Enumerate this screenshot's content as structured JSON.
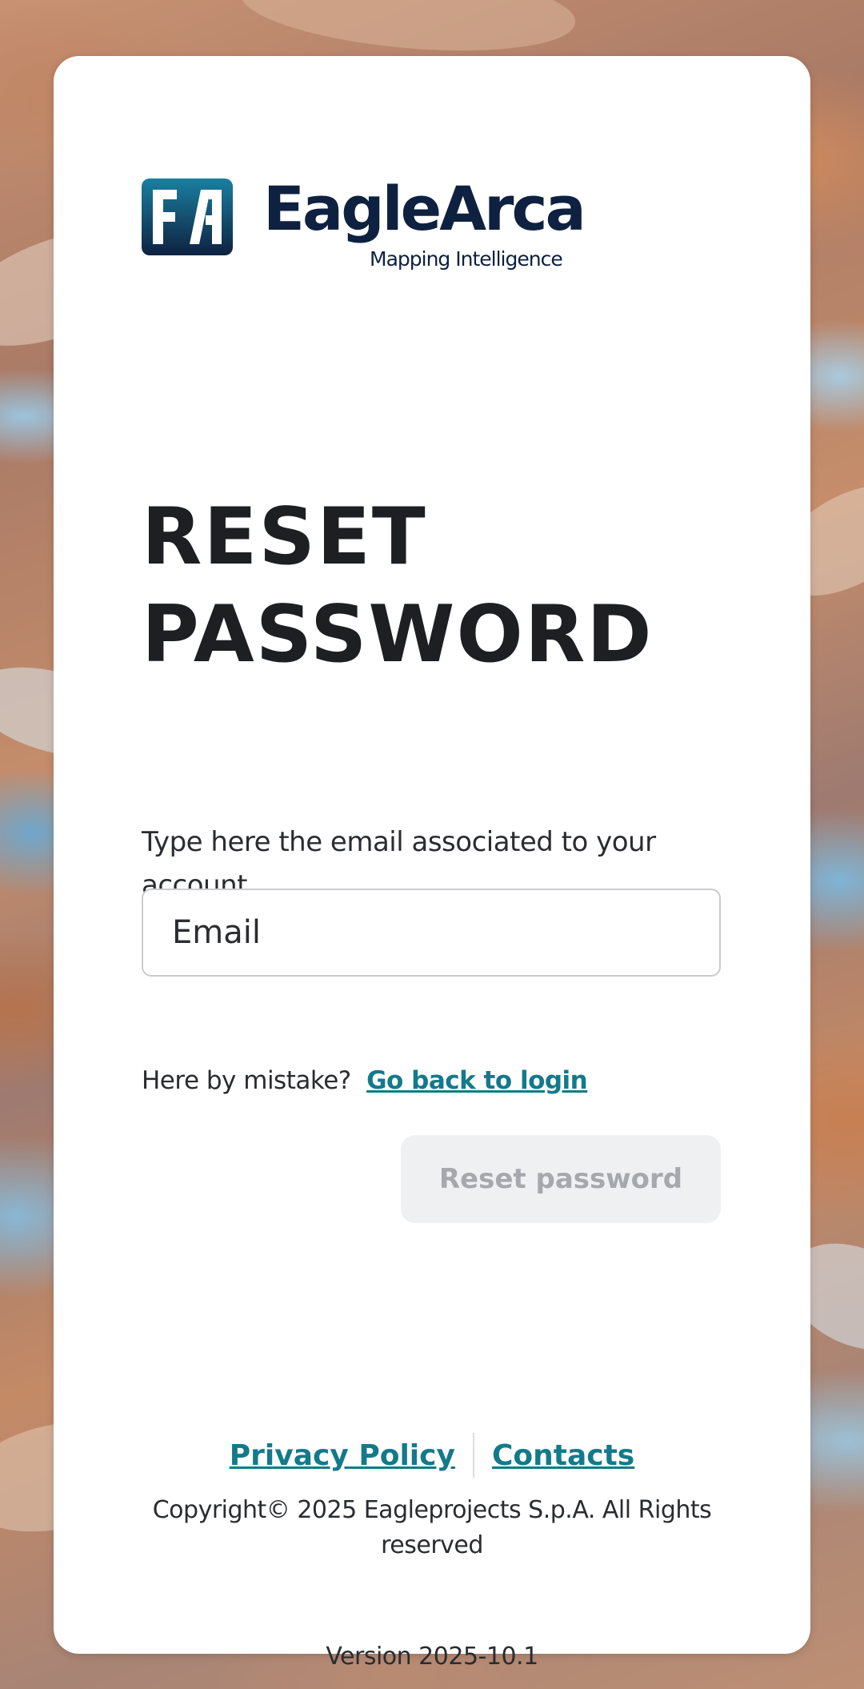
{
  "brand": {
    "name": "EagleArca",
    "tagline": "Mapping Intelligence",
    "logo_icon": "eaglearca-logo-icon",
    "colors": {
      "logo_gradient_top": "#1a7fa0",
      "logo_gradient_bottom": "#0f2140",
      "text_dark": "#0f2140"
    }
  },
  "page": {
    "title": "RESET PASSWORD",
    "description": "Type here the email associated to your account"
  },
  "form": {
    "email_placeholder": "Email",
    "email_value": ""
  },
  "back_to_login": {
    "prompt": "Here by mistake?",
    "link_label": "Go back to login"
  },
  "actions": {
    "reset_label": "Reset password"
  },
  "footer": {
    "privacy_label": "Privacy Policy",
    "contacts_label": "Contacts",
    "copyright": "Copyright© 2025 Eagleprojects S.p.A. All Rights reserved",
    "version": "Version 2025-10.1"
  },
  "colors": {
    "link": "#137a8a",
    "button_disabled_bg": "#eff0f2",
    "button_disabled_text": "#a5a8ad"
  }
}
